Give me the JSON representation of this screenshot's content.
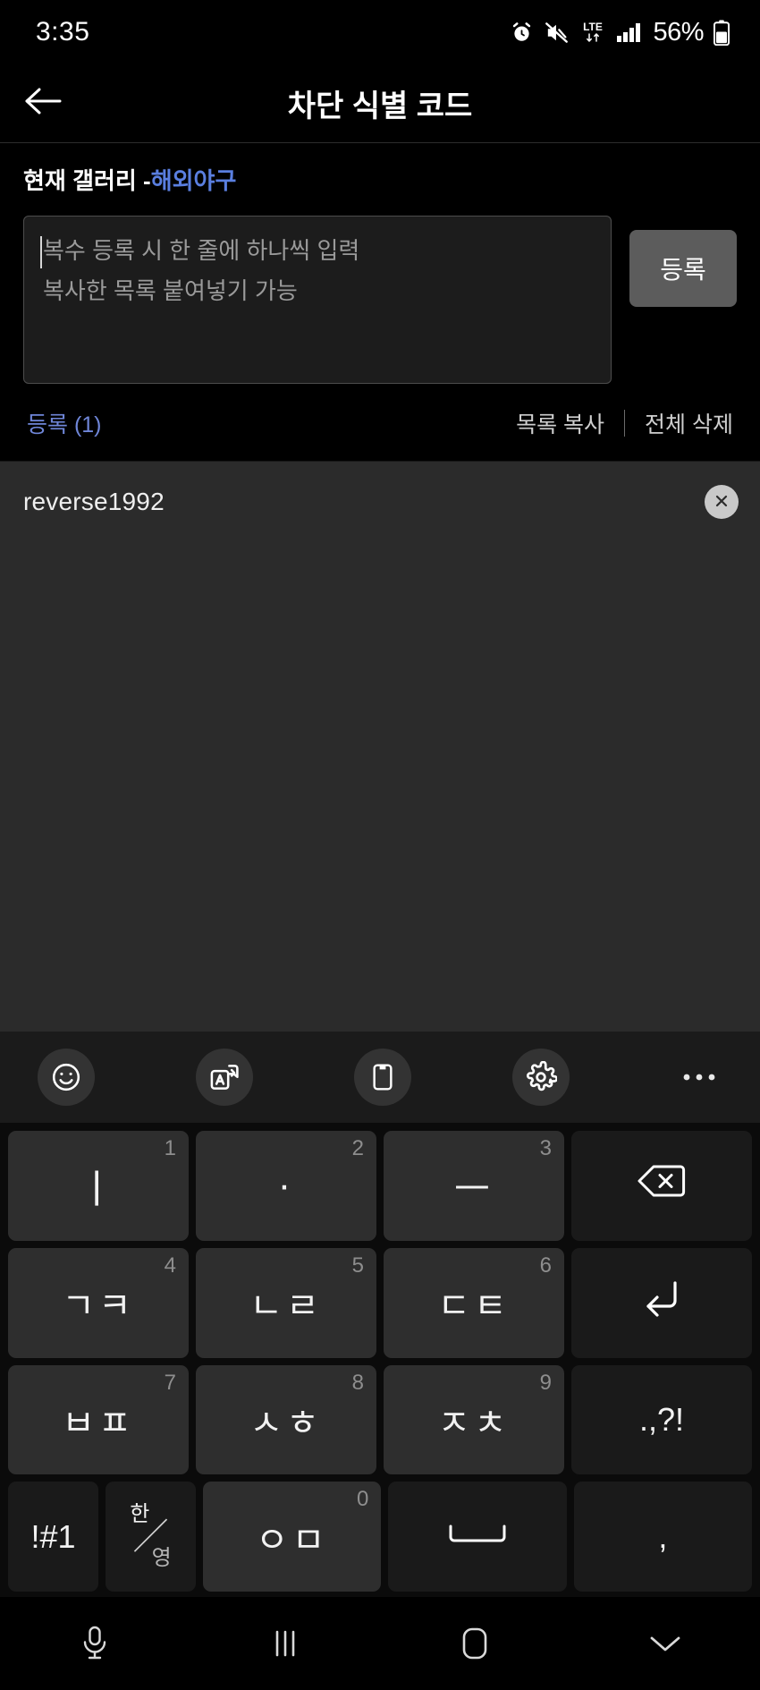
{
  "status_bar": {
    "time": "3:35",
    "battery_percent": "56%",
    "network_type": "LTE",
    "icons": [
      "alarm-icon",
      "mute-icon",
      "lte-icon",
      "signal-icon",
      "battery-icon"
    ]
  },
  "app_bar": {
    "back_icon": "back-arrow-icon",
    "title": "차단 식별 코드"
  },
  "form": {
    "gallery_prefix": "현재 갤러리 - ",
    "gallery_name": "해외야구",
    "gallery_name_color": "#5a7fe0",
    "textarea_value": "",
    "textarea_placeholder": "복수 등록 시 한 줄에 하나씩 입력\n복사한 목록 붙여넣기 가능",
    "submit_label": "등록"
  },
  "meta": {
    "count_label": "등록 (1)",
    "count_color": "#6f86d8",
    "copy_list_label": "목록 복사",
    "delete_all_label": "전체 삭제"
  },
  "list": {
    "items": [
      {
        "text": "reverse1992",
        "delete_icon": "close-circle-icon"
      }
    ]
  },
  "keyboard_toolbar": {
    "items": [
      {
        "name": "emoji-icon",
        "label": "이모티콘"
      },
      {
        "name": "translate-icon",
        "label": "번역"
      },
      {
        "name": "clipboard-icon",
        "label": "클립보드"
      },
      {
        "name": "settings-gear-icon",
        "label": "설정"
      },
      {
        "name": "more-options-icon",
        "label": "더보기"
      }
    ]
  },
  "keyboard": {
    "type": "cheonjiin",
    "rows": [
      [
        {
          "label": "ㅣ",
          "num": "1",
          "name": "key-i",
          "style": "jamo"
        },
        {
          "label": "·",
          "num": "2",
          "name": "key-dot",
          "style": "jamo"
        },
        {
          "label": "ㅡ",
          "num": "3",
          "name": "key-eu",
          "style": "jamo"
        },
        {
          "label": "",
          "num": "",
          "name": "key-backspace",
          "style": "fn-icon",
          "icon": "backspace-icon"
        }
      ],
      [
        {
          "label": "ㄱㅋ",
          "num": "4",
          "name": "key-giyeok-kieuk",
          "style": "jamo"
        },
        {
          "label": "ㄴㄹ",
          "num": "5",
          "name": "key-nieun-rieul",
          "style": "jamo"
        },
        {
          "label": "ㄷㅌ",
          "num": "6",
          "name": "key-digeut-tieut",
          "style": "jamo"
        },
        {
          "label": "",
          "num": "",
          "name": "key-enter",
          "style": "fn-icon",
          "icon": "enter-icon"
        }
      ],
      [
        {
          "label": "ㅂㅍ",
          "num": "7",
          "name": "key-bieup-pieup",
          "style": "jamo"
        },
        {
          "label": "ㅅㅎ",
          "num": "8",
          "name": "key-siot-hieut",
          "style": "jamo"
        },
        {
          "label": "ㅈㅊ",
          "num": "9",
          "name": "key-jieut-chieut",
          "style": "jamo"
        },
        {
          "label": ".,?!",
          "num": "",
          "name": "key-punctuation",
          "style": "fn-sym"
        }
      ],
      [
        {
          "label": "!#1",
          "num": "",
          "name": "key-symbols",
          "style": "fn-sym-narrow"
        },
        {
          "label": "한/영",
          "num": "",
          "name": "key-language-toggle",
          "style": "lang"
        },
        {
          "label": "ㅇㅁ",
          "num": "0",
          "name": "key-ieung-mieum",
          "style": "jamo"
        },
        {
          "label": "",
          "num": "",
          "name": "key-space",
          "style": "fn-icon",
          "icon": "space-icon"
        },
        {
          "label": ",",
          "num": "",
          "name": "key-comma",
          "style": "fn-sym"
        }
      ]
    ]
  },
  "nav_bar": {
    "items": [
      {
        "name": "microphone-icon",
        "label": "음성 입력"
      },
      {
        "name": "recents-icon",
        "label": "최근 앱"
      },
      {
        "name": "home-icon",
        "label": "홈"
      },
      {
        "name": "hide-keyboard-icon",
        "label": "키보드 숨기기"
      }
    ]
  },
  "colors": {
    "background": "#000000",
    "list_background": "#2b2b2b",
    "key_background": "#2e2e2e",
    "accent_blue": "#5a7fe0"
  }
}
